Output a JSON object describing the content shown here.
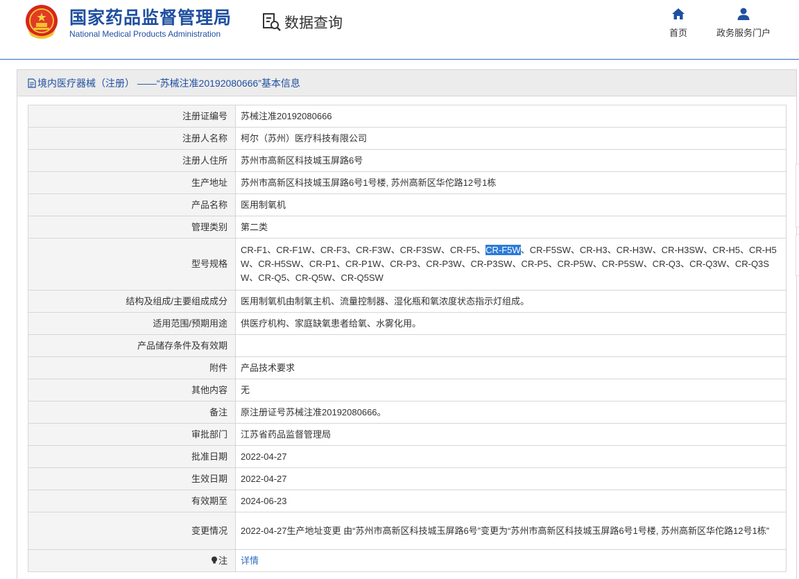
{
  "header": {
    "logo_cn": "国家药品监督管理局",
    "logo_en": "National Medical Products Administration",
    "query_title": "数据查询",
    "nav": [
      {
        "label": "首页",
        "icon": "home-icon"
      },
      {
        "label": "政务服务门户",
        "icon": "user-icon"
      }
    ]
  },
  "panel": {
    "title": "境内医疗器械（注册） ——“苏械注准20192080666”基本信息"
  },
  "rows": [
    {
      "label": "注册证编号",
      "value": "苏械注准20192080666"
    },
    {
      "label": "注册人名称",
      "value": "柯尔（苏州）医疗科技有限公司"
    },
    {
      "label": "注册人住所",
      "value": "苏州市高新区科技城玉屏路6号"
    },
    {
      "label": "生产地址",
      "value": "苏州市高新区科技城玉屏路6号1号楼, 苏州高新区华佗路12号1栋"
    },
    {
      "label": "产品名称",
      "value": "医用制氧机"
    },
    {
      "label": "管理类别",
      "value": "第二类"
    },
    {
      "label": "型号规格",
      "value_before": "CR-F1、CR-F1W、CR-F3、CR-F3W、CR-F3SW、CR-F5、",
      "value_highlight": "CR-F5W",
      "value_after": "、CR-F5SW、CR-H3、CR-H3W、CR-H3SW、CR-H5、CR-H5W、CR-H5SW、CR-P1、CR-P1W、CR-P3、CR-P3W、CR-P3SW、CR-P5、CR-P5W、CR-P5SW、CR-Q3、CR-Q3W、CR-Q3SW、CR-Q5、CR-Q5W、CR-Q5SW"
    },
    {
      "label": "结构及组成/主要组成成分",
      "value": "医用制氧机由制氧主机、流量控制器、湿化瓶和氧浓度状态指示灯组成。"
    },
    {
      "label": "适用范围/预期用途",
      "value": "供医疗机构、家庭缺氧患者给氧、水雾化用。"
    },
    {
      "label": "产品储存条件及有效期",
      "value": ""
    },
    {
      "label": "附件",
      "value": "产品技术要求"
    },
    {
      "label": "其他内容",
      "value": "无"
    },
    {
      "label": "备注",
      "value": "原注册证号苏械注准20192080666。"
    },
    {
      "label": "审批部门",
      "value": "江苏省药品监督管理局"
    },
    {
      "label": "批准日期",
      "value": "2022-04-27"
    },
    {
      "label": "生效日期",
      "value": "2022-04-27"
    },
    {
      "label": "有效期至",
      "value": "2024-06-23"
    },
    {
      "label": "变更情况",
      "value": "2022-04-27生产地址变更 由“苏州市高新区科技城玉屏路6号”变更为“苏州市高新区科技城玉屏路6号1号楼, 苏州高新区华佗路12号1栋”"
    },
    {
      "label": "注",
      "value": "详情",
      "icon": "lightbulb-icon"
    }
  ],
  "colors": {
    "brand_blue": "#1f4fa0",
    "link_blue": "#2a6fc4",
    "highlight": "#2b7bd6",
    "label_bg": "#f4f4f4",
    "panel_head_bg": "#ececec"
  }
}
